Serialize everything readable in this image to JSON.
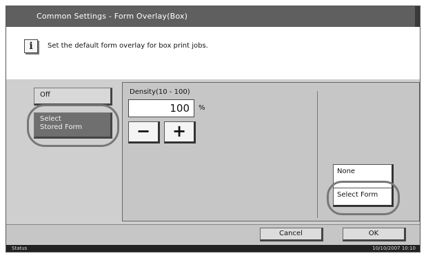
{
  "header": {
    "title": "Common Settings - Form Overlay(Box)"
  },
  "message": {
    "icon": "info-icon",
    "text": "Set the default form overlay for box print jobs."
  },
  "mode_buttons": [
    {
      "label": "Off",
      "selected": false
    },
    {
      "label": "Select\nStored Form",
      "selected": true
    }
  ],
  "density": {
    "label": "Density(10 - 100)",
    "value": "100",
    "unit": "%",
    "minus_label": "−",
    "plus_label": "+"
  },
  "forms": {
    "current": "None",
    "select_label": "Select Form"
  },
  "actions": {
    "cancel_label": "Cancel",
    "ok_label": "OK"
  },
  "statusbar": {
    "status_label": "Status",
    "datetime": "10/10/2007  10:10"
  }
}
